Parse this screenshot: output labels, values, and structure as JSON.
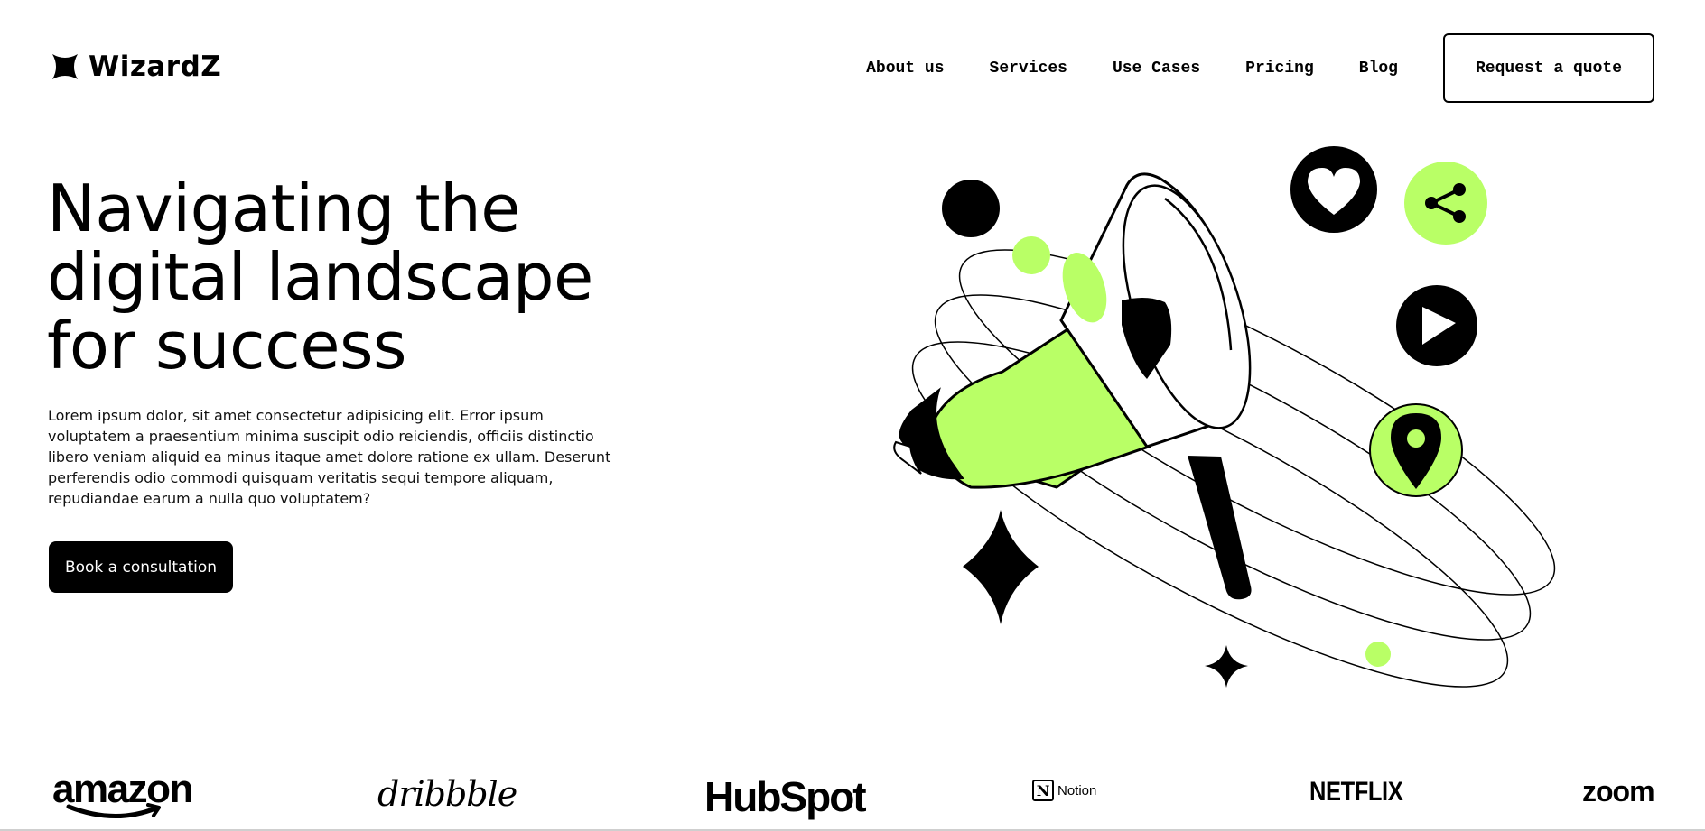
{
  "brand": {
    "name": "WizardZ",
    "logo_icon": "four-point-star-icon"
  },
  "nav": {
    "links": [
      "About us",
      "Services",
      "Use Cases",
      "Pricing",
      "Blog"
    ],
    "quote_button": "Request a quote"
  },
  "hero": {
    "title": "Navigating the digital landscape for success",
    "description": "Lorem ipsum dolor, sit amet consectetur adipisicing elit. Error ipsum voluptatem a praesentium minima suscipit odio reiciendis, officiis distinctio libero veniam aliquid ea minus itaque amet dolore ratione ex ullam. Deserunt perferendis odio commodi quisquam veritatis sequi tempore aliquam, repudiandae earum a nulla quo voluptatem?",
    "cta_button": "Book a consultation"
  },
  "illustration": {
    "icons": [
      "megaphone-icon",
      "heart-icon",
      "share-icon",
      "play-icon",
      "location-pin-icon",
      "sparkle-star-icon"
    ],
    "colors": {
      "accent": "#b9ff66",
      "dark": "#000000",
      "background": "#ffffff"
    }
  },
  "brands": {
    "amazon": "amazon",
    "dribbble": "dribbble",
    "hubspot": "HubSpot",
    "notion": "Notion",
    "notion_icon_letter": "N",
    "netflix": "NETFLIX",
    "zoom": "zoom"
  }
}
